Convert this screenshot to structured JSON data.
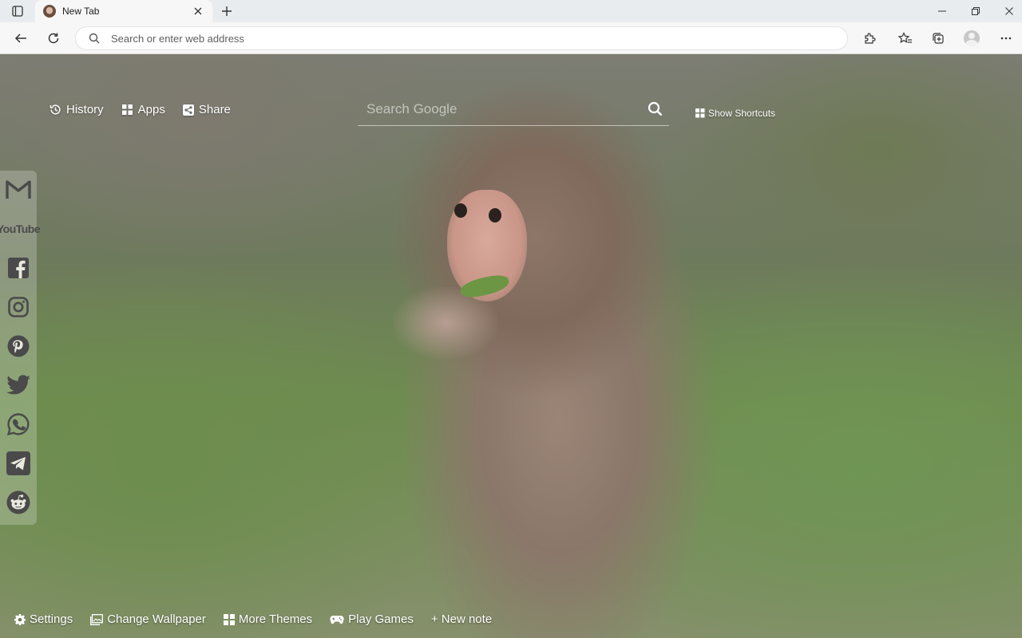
{
  "tab": {
    "title": "New Tab"
  },
  "address_bar": {
    "placeholder": "Search or enter web address"
  },
  "newtab": {
    "top_links": [
      {
        "label": "History",
        "icon": "history-icon"
      },
      {
        "label": "Apps",
        "icon": "apps-grid-icon"
      },
      {
        "label": "Share",
        "icon": "share-icon"
      }
    ],
    "search": {
      "placeholder": "Search Google"
    },
    "shortcuts_label": "Show Shortcuts",
    "social_links": [
      "gmail-icon",
      "youtube-icon",
      "facebook-icon",
      "instagram-icon",
      "pinterest-icon",
      "twitter-icon",
      "whatsapp-icon",
      "telegram-icon",
      "reddit-icon"
    ],
    "youtube_logo_text": "YouTube",
    "bottom_links": [
      {
        "label": "Settings",
        "icon": "gear-icon"
      },
      {
        "label": "Change Wallpaper",
        "icon": "image-icon"
      },
      {
        "label": "More Themes",
        "icon": "grid-icon"
      },
      {
        "label": "Play Games",
        "icon": "gamepad-icon"
      },
      {
        "label": "+ New note",
        "icon": ""
      }
    ]
  },
  "colors": {
    "text_on_wallpaper": "#ffffff",
    "chrome_bg": "#f7f7f7",
    "tabstrip_bg": "#e9ecef"
  }
}
